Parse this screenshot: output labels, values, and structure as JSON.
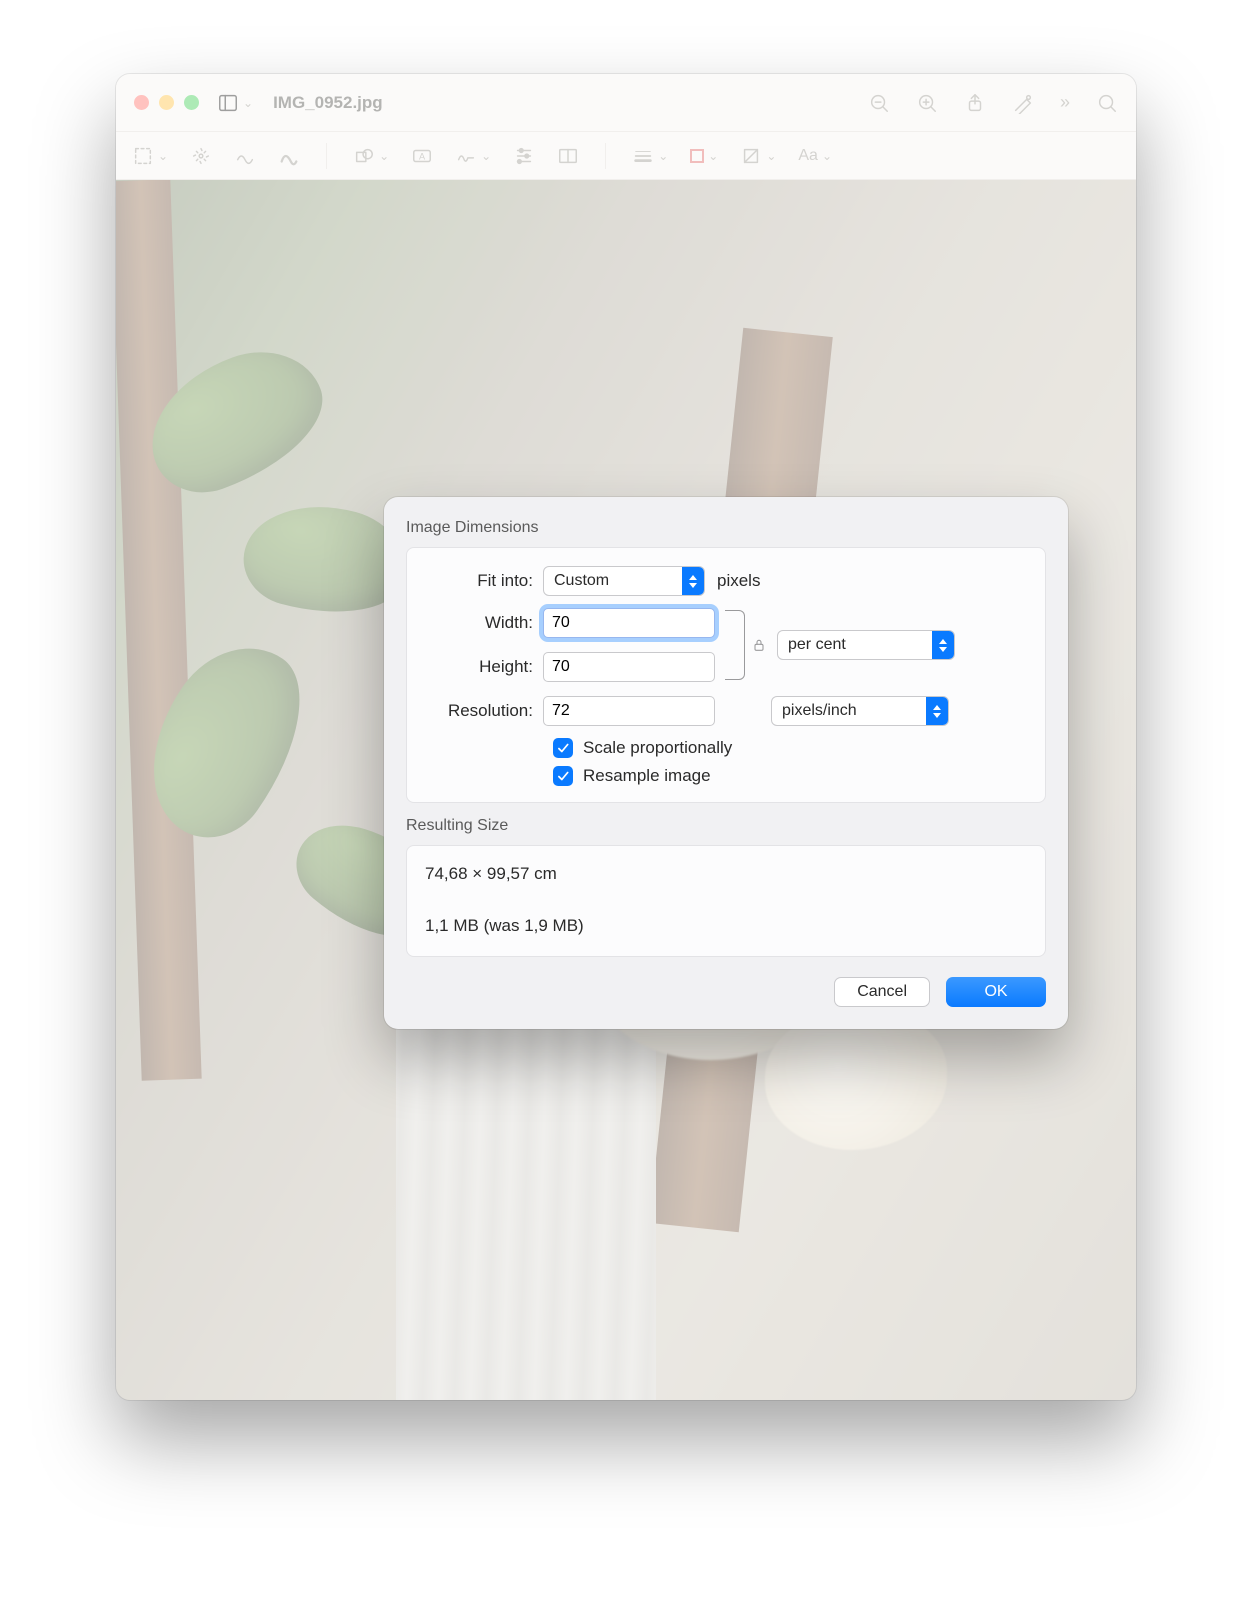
{
  "window": {
    "filename": "IMG_0952.jpg"
  },
  "dialog": {
    "title": "Image Dimensions",
    "fit_label": "Fit into:",
    "fit_value": "Custom",
    "fit_unit": "pixels",
    "width_label": "Width:",
    "width_value": "70",
    "height_label": "Height:",
    "height_value": "70",
    "wh_unit": "per cent",
    "resolution_label": "Resolution:",
    "resolution_value": "72",
    "resolution_unit": "pixels/inch",
    "scale_prop": "Scale proportionally",
    "resample": "Resample image",
    "result_title": "Resulting Size",
    "result_dim": "74,68 × 99,57 cm",
    "result_size": "1,1 MB (was 1,9 MB)",
    "cancel": "Cancel",
    "ok": "OK"
  }
}
